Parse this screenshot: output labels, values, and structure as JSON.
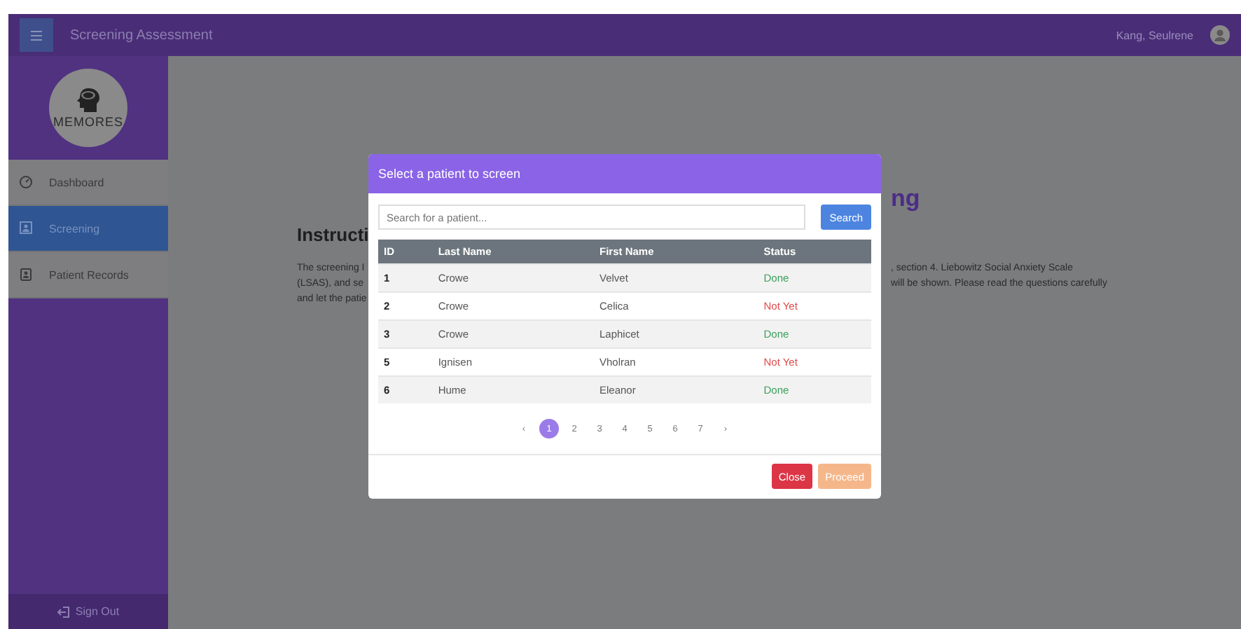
{
  "app_bar": {
    "title": "Screening Assessment",
    "user": "Kang, Seulrene"
  },
  "sidebar": {
    "logo_text": "MEMORES",
    "items": [
      {
        "label": "Dashboard",
        "kind": "dashboard",
        "selected": false
      },
      {
        "label": "Screening",
        "kind": "screening",
        "selected": true
      },
      {
        "label": "Patient Records",
        "kind": "records",
        "selected": false
      }
    ],
    "sign_out": "Sign Out"
  },
  "page": {
    "heading_visible": "ng",
    "subheading_visible": "Instructi",
    "paragraph_left_lines": [
      "The screening I",
      "(LSAS), and se",
      "and let the patie"
    ],
    "paragraph_right_lines": [
      ", section 4. Liebowitz Social Anxiety Scale",
      "will be shown. Please read the questions carefully"
    ]
  },
  "modal": {
    "title": "Select a patient to screen",
    "search": {
      "placeholder": "Search for a patient..."
    },
    "search_button": "Search",
    "table": {
      "columns": [
        "ID",
        "Last Name",
        "First Name",
        "Status"
      ],
      "rows": [
        {
          "id": "1",
          "last_name": "Crowe",
          "first_name": "Velvet",
          "status": "Done",
          "kind": "done"
        },
        {
          "id": "2",
          "last_name": "Crowe",
          "first_name": "Celica",
          "status": "Not Yet",
          "kind": "pending"
        },
        {
          "id": "3",
          "last_name": "Crowe",
          "first_name": "Laphicet",
          "status": "Done",
          "kind": "done"
        },
        {
          "id": "5",
          "last_name": "Ignisen",
          "first_name": "Vholran",
          "status": "Not Yet",
          "kind": "pending"
        },
        {
          "id": "6",
          "last_name": "Hume",
          "first_name": "Eleanor",
          "status": "Done",
          "kind": "done"
        }
      ]
    },
    "pagination": {
      "prev": "‹",
      "pages": [
        {
          "label": "1",
          "selected": true
        },
        {
          "label": "2",
          "selected": false
        },
        {
          "label": "3",
          "selected": false
        },
        {
          "label": "4",
          "selected": false
        },
        {
          "label": "5",
          "selected": false
        },
        {
          "label": "6",
          "selected": false
        },
        {
          "label": "7",
          "selected": false
        }
      ],
      "next": "›"
    },
    "buttons": [
      {
        "label": "Close",
        "kind": "danger",
        "disabled": false
      },
      {
        "label": "Proceed",
        "kind": "primary",
        "disabled": true
      }
    ]
  }
}
